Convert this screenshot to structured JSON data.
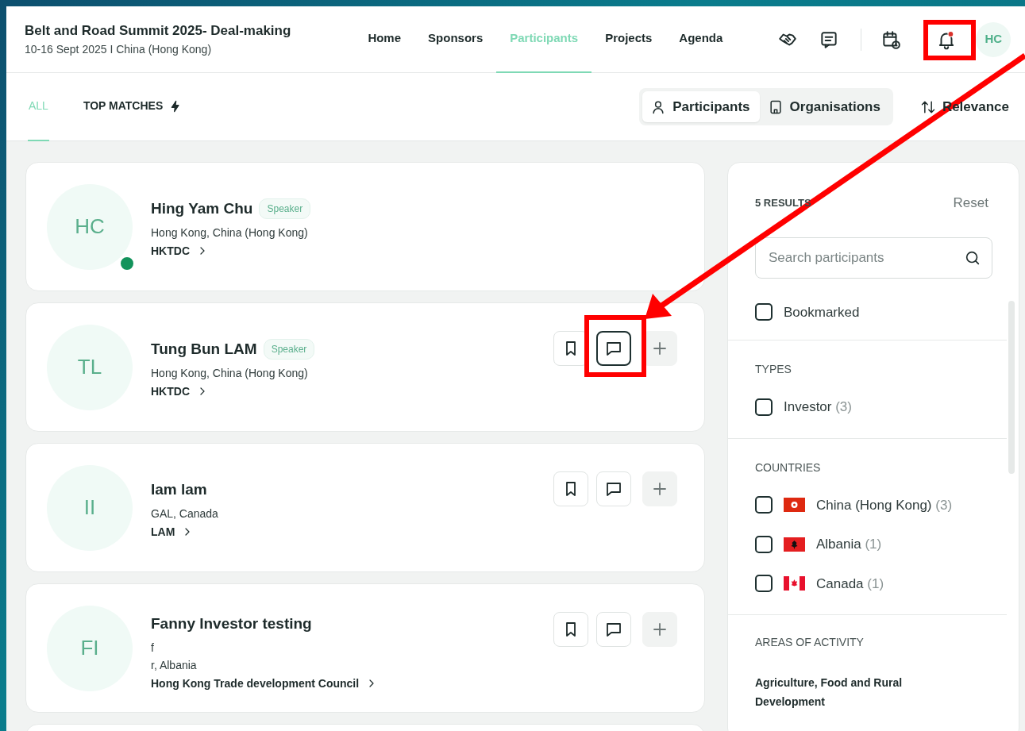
{
  "header": {
    "title": "Belt and Road Summit 2025- Deal-making",
    "subtitle": "10-16 Sept 2025 I China (Hong Kong)",
    "nav": [
      {
        "label": "Home",
        "selected": false
      },
      {
        "label": "Sponsors",
        "selected": false
      },
      {
        "label": "Participants",
        "selected": true
      },
      {
        "label": "Projects",
        "selected": false
      },
      {
        "label": "Agenda",
        "selected": false
      }
    ],
    "notification_unread": true,
    "avatar": "HC"
  },
  "filter_tabs": [
    {
      "label": "ALL",
      "selected": true
    },
    {
      "label": "TOP MATCHES",
      "selected": false
    }
  ],
  "view_toggle": [
    {
      "label": "Participants",
      "selected": true
    },
    {
      "label": "Organisations",
      "selected": false
    }
  ],
  "sort": "Relevance",
  "participants": [
    {
      "initials": "HC",
      "name": "Hing Yam Chu",
      "badge": "Speaker",
      "details": [
        "Hong Kong, China (Hong Kong)"
      ],
      "organisation": "HKTDC",
      "online": true,
      "actions": false
    },
    {
      "initials": "TL",
      "name": "Tung Bun LAM",
      "badge": "Speaker",
      "details": [
        "Hong Kong, China (Hong Kong)"
      ],
      "organisation": "HKTDC",
      "online": false,
      "actions": true
    },
    {
      "initials": "II",
      "name": "Iam lam",
      "details": [
        "GAL, Canada"
      ],
      "organisation": "LAM",
      "online": false,
      "actions": true
    },
    {
      "initials": "FI",
      "name": "Fanny Investor testing",
      "details": [
        "f",
        "r, Albania"
      ],
      "organisation": "Hong Kong Trade development Council",
      "online": false,
      "actions": true
    }
  ],
  "sidebar": {
    "results": "5 RESULTS",
    "reset": "Reset",
    "search": {
      "placeholder": "Search participants"
    },
    "bookmarked": {
      "label": "Bookmarked",
      "checked": false
    },
    "sections": [
      {
        "title": "TYPES",
        "options": [
          {
            "label": "Investor",
            "count": "(3)",
            "checked": false
          }
        ]
      },
      {
        "title": "COUNTRIES",
        "options": [
          {
            "label": "China (Hong Kong)",
            "count": "(3)",
            "checked": false
          },
          {
            "label": "Albania",
            "count": "(1)",
            "checked": false
          },
          {
            "label": "Canada",
            "count": "(1)",
            "checked": false
          }
        ]
      },
      {
        "title": "AREAS OF ACTIVITY",
        "items": [
          "Agriculture, Food and Rural Development"
        ]
      }
    ]
  },
  "annotations": [
    {
      "kind": "box"
    },
    {
      "kind": "box"
    },
    {
      "kind": "arrow"
    }
  ]
}
